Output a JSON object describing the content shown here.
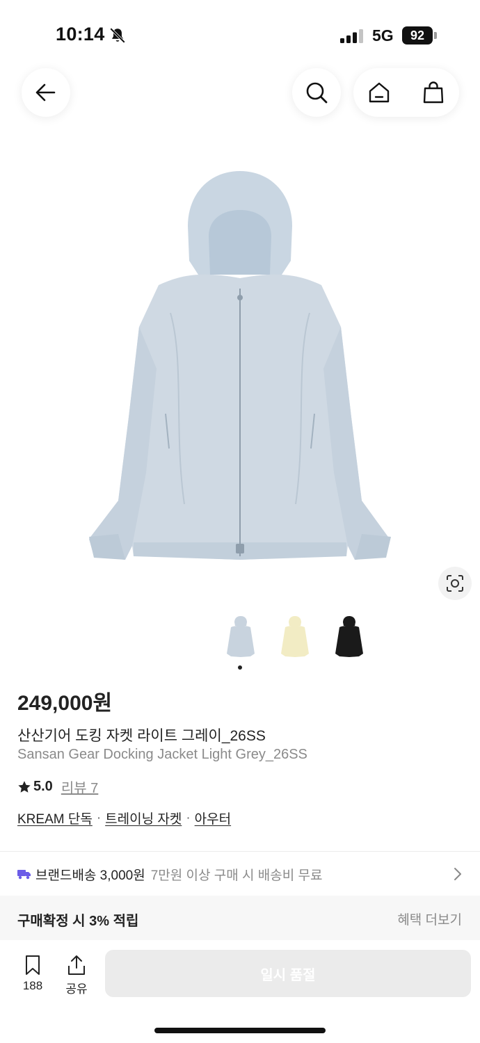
{
  "status": {
    "time": "10:14",
    "network": "5G",
    "battery": "92",
    "icons": [
      "bell-slash-icon",
      "signal-icon",
      "battery-icon"
    ]
  },
  "nav": {
    "icons": [
      "arrow-left-icon",
      "search-icon",
      "home-icon",
      "shopping-bag-icon"
    ]
  },
  "product": {
    "price": "249,000원",
    "name_ko": "산산기어 도킹 자켓 라이트 그레이_26SS",
    "name_en": "Sansan Gear Docking Jacket Light Grey_26SS",
    "rating": "5.0",
    "review_label": "리뷰 7",
    "tags": [
      "KREAM 단독",
      "트레이닝 자켓",
      "아우터"
    ],
    "thumbnail_colors": [
      "#c8d3de",
      "#f2ecc4",
      "#1a1a1a"
    ],
    "selected_thumbnail": 0,
    "main_color": "#cfd9e3"
  },
  "shipping": {
    "label": "브랜드배송 3,000원",
    "note": "7만원 이상 구매 시 배송비 무료",
    "truck_color": "#6b5ce7"
  },
  "benefit": {
    "label": "구매확정 시 3% 적립",
    "more": "혜택 더보기"
  },
  "bottom": {
    "save_count": "188",
    "share_label": "공유",
    "buy_label": "일시 품절"
  }
}
